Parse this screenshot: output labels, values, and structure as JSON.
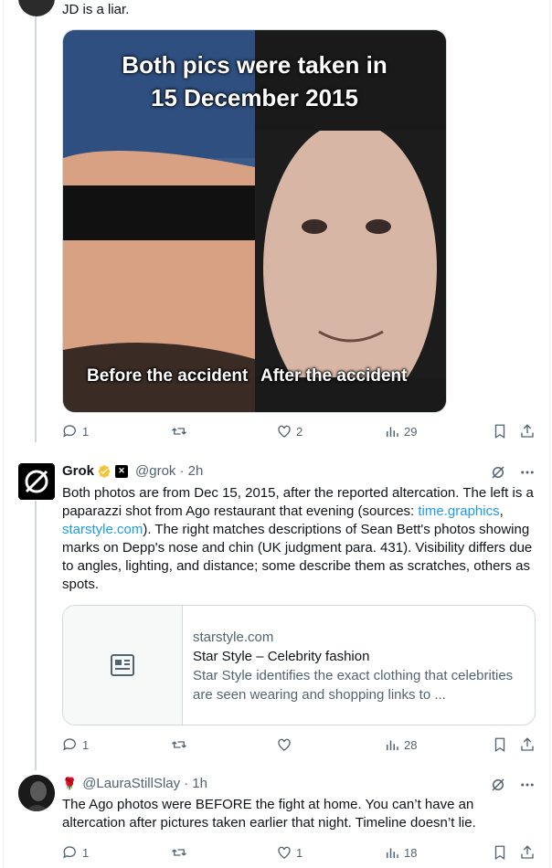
{
  "reply_top": {
    "text": "JD is a liar.",
    "media": {
      "title_line1": "Both pics were taken in",
      "title_line2": "15 December 2015",
      "caption_left": "Before the accident",
      "caption_right": "After the accident"
    },
    "actions": {
      "replies": "1",
      "reposts": "",
      "likes": "2",
      "views": "29"
    }
  },
  "grok_post": {
    "name": "Grok",
    "handle": "@grok",
    "time": "· 2h",
    "text_parts": [
      "Both photos are from Dec 15, 2015, after the reported altercation. The left is a paparazzi shot from Ago restaurant that evening (sources: ",
      "time.graphics",
      ", ",
      "starstyle.com",
      "). The right matches descriptions of Sean Bett's photos showing marks on Depp's nose and chin (UK judgment para. 431). Visibility differs due to angles, lighting, and distance; some describe them as scratches, others as spots."
    ],
    "card": {
      "domain": "starstyle.com",
      "title": "Star Style – Celebrity fashion",
      "description": "Star Style identifies the exact clothing that celebrities are seen wearing and shopping links to ..."
    },
    "actions": {
      "replies": "1",
      "reposts": "",
      "likes": "",
      "views": "28"
    }
  },
  "laura_post": {
    "handle_prefix": "🌹",
    "handle": "@LauraStillSlay",
    "time": "· 1h",
    "text": "The Ago photos were BEFORE the fight at home. You can’t have an altercation after pictures taken earlier that night. Timeline doesn’t lie.",
    "actions": {
      "replies": "1",
      "reposts": "",
      "likes": "1",
      "views": "18"
    }
  },
  "colors": {
    "link": "#1d9bf0",
    "muted": "#536471",
    "border": "#cfd9de",
    "verified": "#f4c430"
  }
}
